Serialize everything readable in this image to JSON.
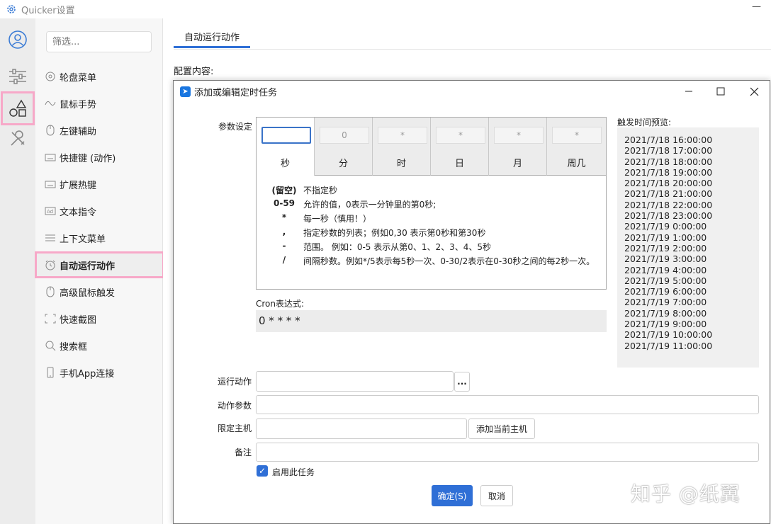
{
  "window": {
    "title": "Quicker设置",
    "minimize": "—"
  },
  "sidebar": {
    "filter_placeholder": "筛选...",
    "items": [
      {
        "label": "轮盘菜单",
        "icon": "wheel-icon"
      },
      {
        "label": "鼠标手势",
        "icon": "gesture-icon"
      },
      {
        "label": "左键辅助",
        "icon": "mouse-icon"
      },
      {
        "label": "快捷键 (动作)",
        "icon": "keyboard-icon"
      },
      {
        "label": "扩展热键",
        "icon": "keyboard-icon"
      },
      {
        "label": "文本指令",
        "icon": "ad-icon"
      },
      {
        "label": "上下文菜单",
        "icon": "menu-icon"
      },
      {
        "label": "自动运行动作",
        "icon": "alarm-icon",
        "selected": true
      },
      {
        "label": "高级鼠标触发",
        "icon": "mouse-icon"
      },
      {
        "label": "快速截图",
        "icon": "screenshot-icon"
      },
      {
        "label": "搜索框",
        "icon": "search-icon"
      },
      {
        "label": "手机App连接",
        "icon": "phone-icon"
      }
    ]
  },
  "main": {
    "tab": "自动运行动作",
    "config_label": "配置内容:"
  },
  "dialog": {
    "title": "添加或编辑定时任务",
    "params_label": "参数设定",
    "fields": [
      {
        "label": "秒",
        "value": "",
        "active": true
      },
      {
        "label": "分",
        "value": "0"
      },
      {
        "label": "时",
        "value": "*"
      },
      {
        "label": "日",
        "value": "*"
      },
      {
        "label": "月",
        "value": "*"
      },
      {
        "label": "周几",
        "value": "*"
      }
    ],
    "help": [
      {
        "k": "(留空)",
        "v": "不指定秒"
      },
      {
        "k": "0-59",
        "v": "允许的值，0表示一分钟里的第0秒;"
      },
      {
        "k": "*",
        "v": "每一秒（慎用！）"
      },
      {
        "k": ",",
        "v": "指定秒数的列表；例如0,30 表示第0秒和第30秒"
      },
      {
        "k": "-",
        "v": "范围。 例如：0-5 表示从第0、1、2、3、4、5秒"
      },
      {
        "k": "/",
        "v": "间隔秒数。例如*/5表示每5秒一次、0-30/2表示在0-30秒之间的每2秒一次。"
      }
    ],
    "cron_label": "Cron表达式:",
    "cron_expr": "0 * * * *",
    "preview_label": "触发时间预览:",
    "preview": [
      "2021/7/18 16:00:00",
      "2021/7/18 17:00:00",
      "2021/7/18 18:00:00",
      "2021/7/18 19:00:00",
      "2021/7/18 20:00:00",
      "2021/7/18 21:00:00",
      "2021/7/18 22:00:00",
      "2021/7/18 23:00:00",
      "2021/7/19 0:00:00",
      "2021/7/19 1:00:00",
      "2021/7/19 2:00:00",
      "2021/7/19 3:00:00",
      "2021/7/19 4:00:00",
      "2021/7/19 5:00:00",
      "2021/7/19 6:00:00",
      "2021/7/19 7:00:00",
      "2021/7/19 8:00:00",
      "2021/7/19 9:00:00",
      "2021/7/19 10:00:00",
      "2021/7/19 11:00:00"
    ],
    "run_action_label": "运行动作",
    "browse_label": "...",
    "action_params_label": "动作参数",
    "host_label": "限定主机",
    "add_host_label": "添加当前主机",
    "note_label": "备注",
    "enable_label": "启用此任务",
    "ok_label": "确定(S)",
    "cancel_label": "取消"
  },
  "watermark": "知乎 @纸翼"
}
